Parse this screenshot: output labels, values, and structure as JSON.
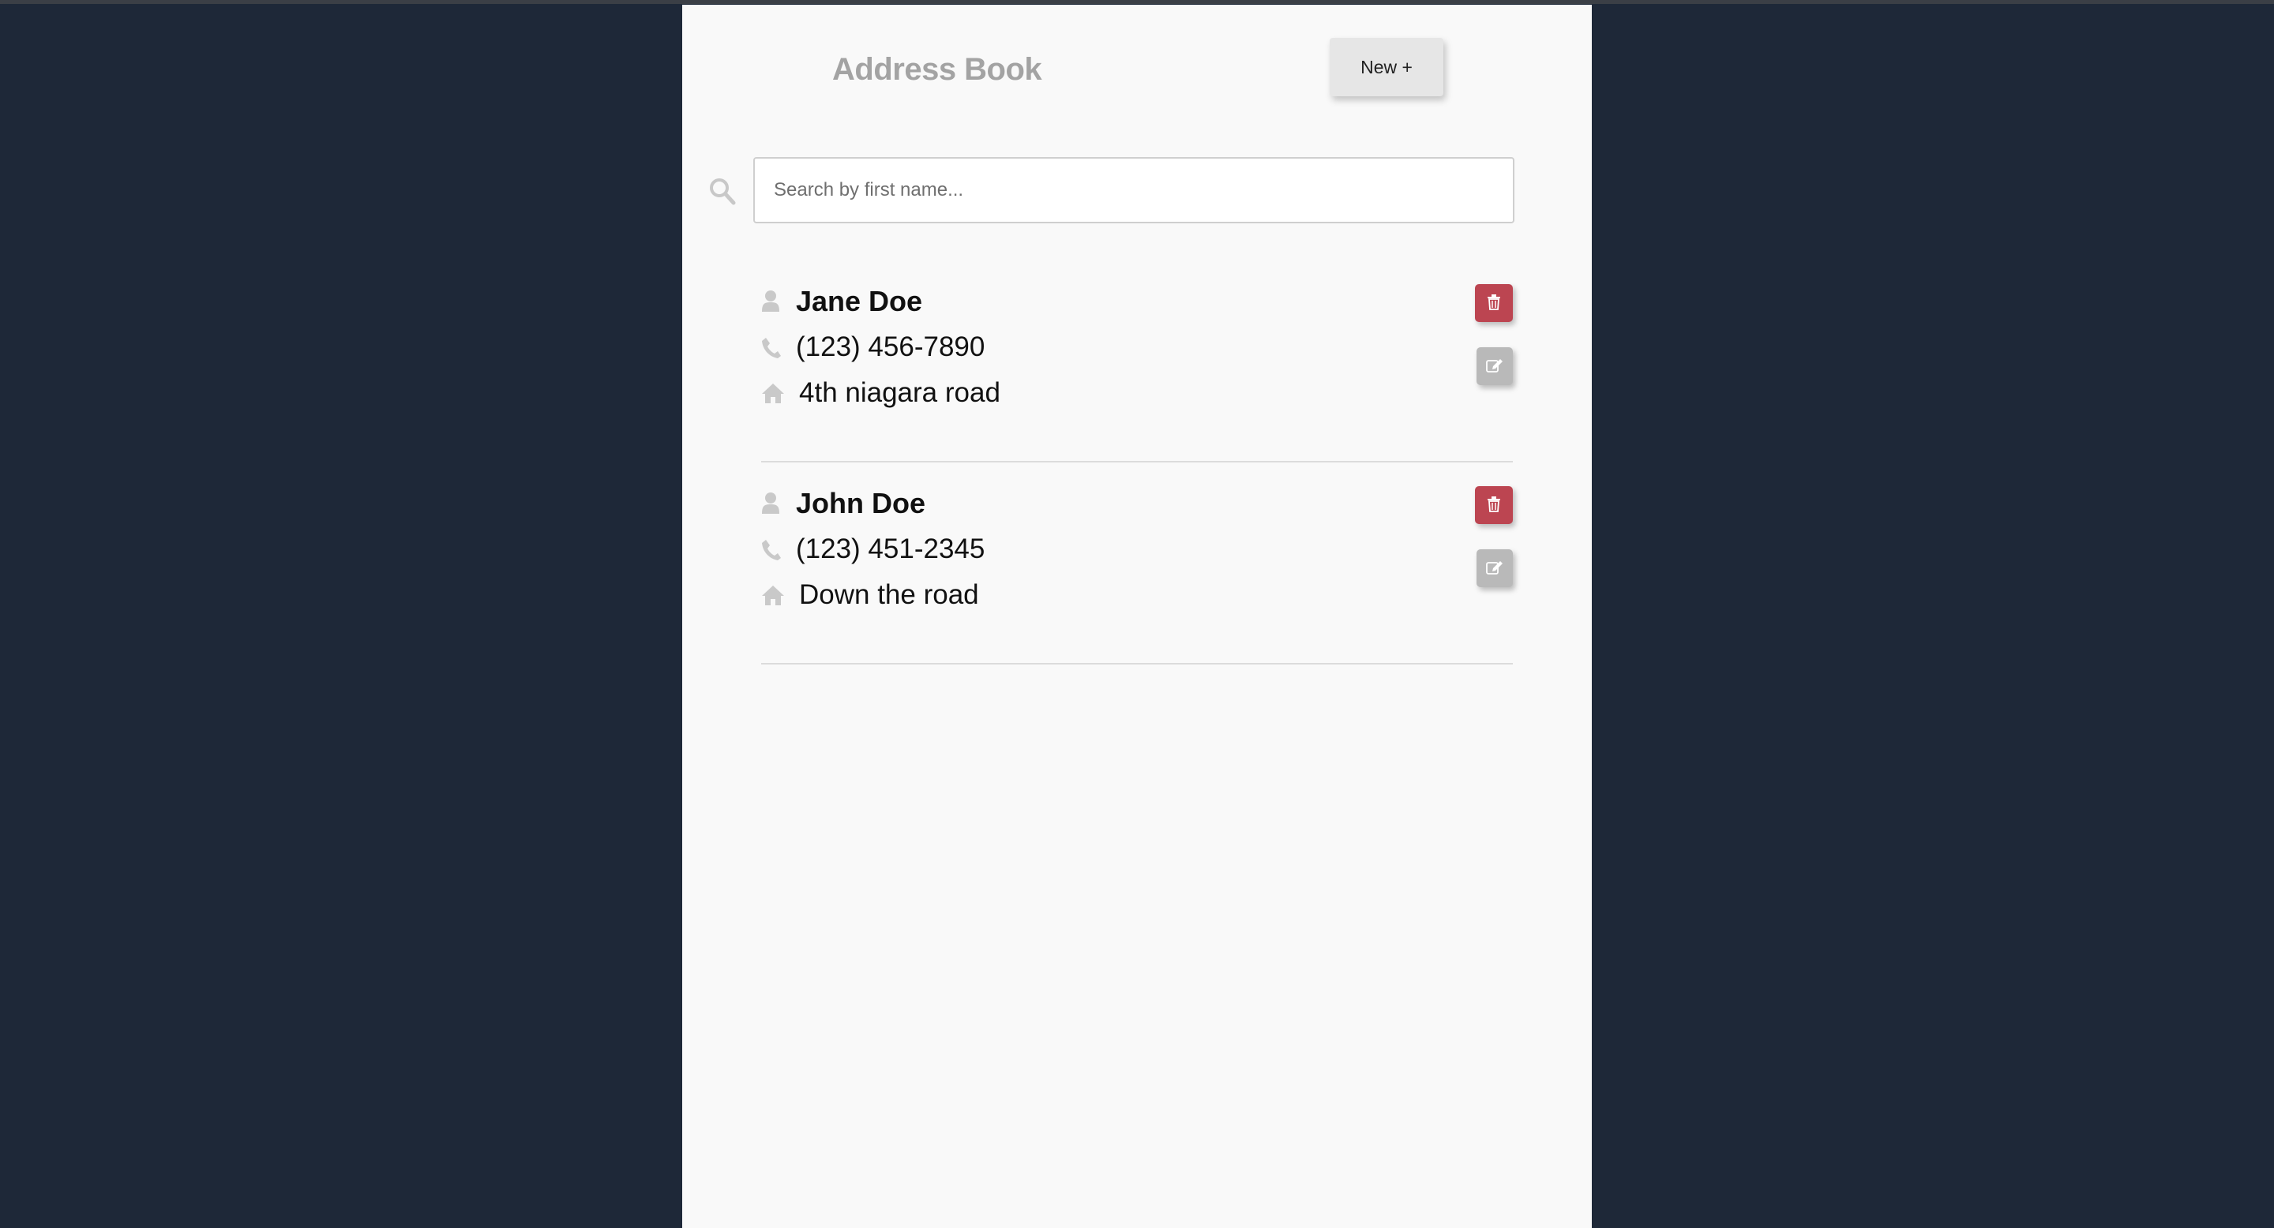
{
  "header": {
    "title": "Address Book",
    "new_button_label": "New +"
  },
  "search": {
    "placeholder": "Search by first name...",
    "value": "",
    "icon": "search-icon"
  },
  "contacts": [
    {
      "name": "Jane Doe",
      "phone": "(123) 456-7890",
      "address": "4th niagara road"
    },
    {
      "name": "John Doe",
      "phone": "(123) 451-2345",
      "address": "Down the road"
    }
  ],
  "icons": {
    "name": "user-icon",
    "phone": "phone-icon",
    "address": "home-icon",
    "delete": "trash-icon",
    "edit": "edit-icon"
  },
  "colors": {
    "background": "#1e2838",
    "panel": "#f9f9f9",
    "delete_button": "#bc4551",
    "edit_button": "#b9b9b9",
    "new_button": "#e6e6e6",
    "title": "#a3a3a3"
  }
}
